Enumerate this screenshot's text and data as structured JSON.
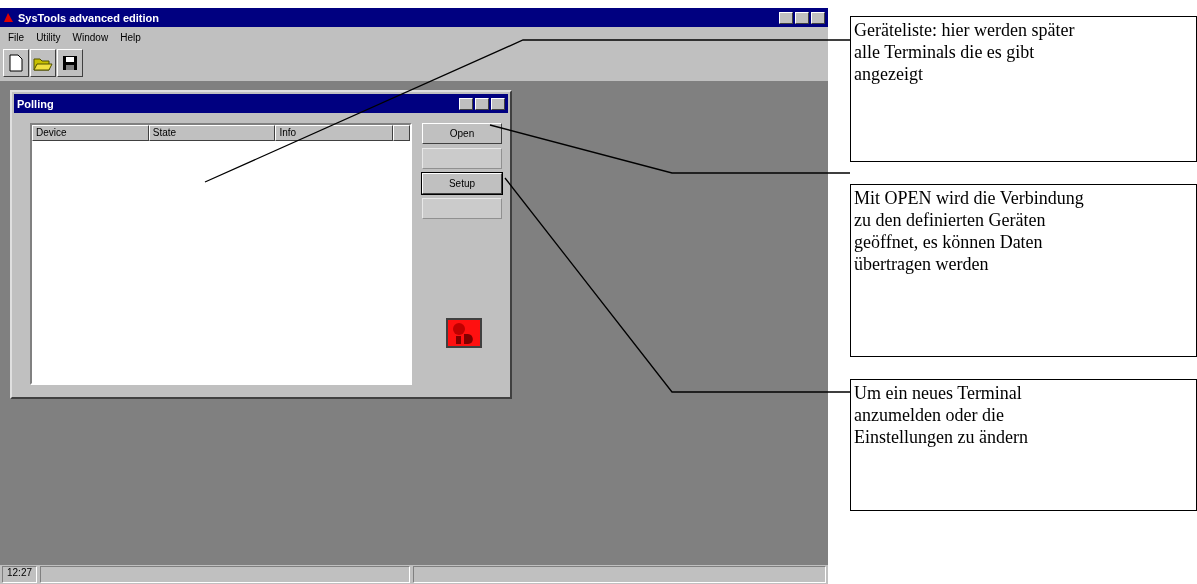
{
  "window": {
    "title": "SysTools advanced edition"
  },
  "menu": [
    "File",
    "Utility",
    "Window",
    "Help"
  ],
  "child_window": {
    "title": "Polling",
    "columns": [
      {
        "label": "Device"
      },
      {
        "label": "State"
      },
      {
        "label": "Info"
      },
      {}
    ],
    "buttons": [
      {
        "label": "Open",
        "disabled": false,
        "focused": false
      },
      {
        "disabled": true,
        "focused": false
      },
      {
        "label": "Setup",
        "disabled": false,
        "focused": true
      },
      {
        "disabled": true,
        "focused": false
      }
    ]
  },
  "status_bar": {
    "time": "12:27"
  },
  "callouts": [
    "Geräteliste: hier werden später alle Terminals die es gibt angezeigt",
    "Mit OPEN wird die Verbindung zu den definierten Geräten geöffnet, es können Daten übertragen werden",
    "Um ein neues Terminal anzumelden oder die Einstellungen zu ändern"
  ]
}
